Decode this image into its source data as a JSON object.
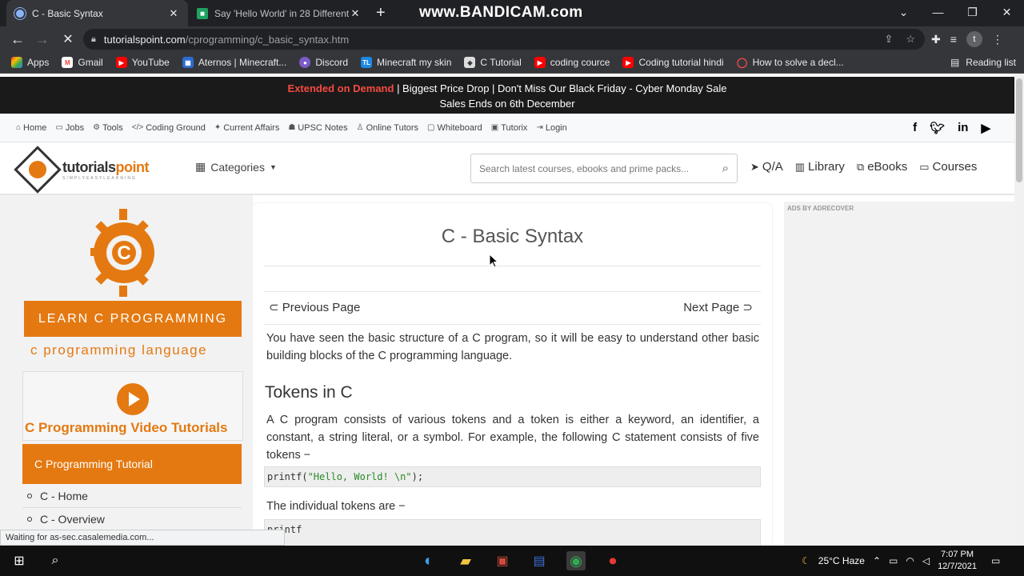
{
  "browser": {
    "tabs": [
      {
        "title": "C - Basic Syntax",
        "active": true
      },
      {
        "title": "Say 'Hello World' in 28 Different",
        "active": false
      }
    ],
    "recorder_watermark": "www.BANDICAM.com",
    "url_host": "tutorialspoint.com",
    "url_path": "/cprogramming/c_basic_syntax.htm",
    "bookmarks": [
      "Apps",
      "Gmail",
      "YouTube",
      "Aternos | Minecraft...",
      "Discord",
      "Minecraft my skin",
      "C Tutorial",
      "coding cource",
      "Coding tutorial hindi",
      "How to solve a decl..."
    ],
    "reading_list": "Reading list",
    "avatar_letter": "t",
    "status_text": "Waiting for as-sec.casalemedia.com..."
  },
  "promo": {
    "highlight": "Extended on Demand",
    "text": " | Biggest Price Drop | Don't Miss Our Black Friday - Cyber Monday Sale",
    "line2": "Sales Ends on 6th December"
  },
  "topnav": [
    "Home",
    "Jobs",
    "Tools",
    "Coding Ground",
    "Current Affairs",
    "UPSC Notes",
    "Online Tutors",
    "Whiteboard",
    "Tutorix",
    "Login"
  ],
  "social": [
    "f",
    "t",
    "in",
    "yt"
  ],
  "header": {
    "brand_a": "tutorials",
    "brand_b": "point",
    "tagline": "SIMPLYEASYLEARNING",
    "categories": "Categories",
    "search_placeholder": "Search latest courses, ebooks and prime packs...",
    "links": [
      "Q/A",
      "Library",
      "eBooks",
      "Courses"
    ]
  },
  "sidebar": {
    "learn_banner": "LEARN C PROGRAMMING",
    "subtitle": "c programming language",
    "video_title": "C Programming Video Tutorials",
    "tutorial_button": "C Programming Tutorial",
    "items": [
      "C - Home",
      "C - Overview"
    ]
  },
  "content": {
    "title": "C - Basic Syntax",
    "prev": "Previous Page",
    "next": "Next Page",
    "intro": "You have seen the basic structure of a C program, so it will be easy to understand other basic building blocks of the C programming language.",
    "h_tokens": "Tokens in C",
    "tokens_para": "A C program consists of various tokens and a token is either a keyword, an identifier, a constant, a string literal, or a symbol. For example, the following C statement consists of five tokens −",
    "code1_fn": "printf(",
    "code1_str": "\"Hello, World! \\n\"",
    "code1_end": ");",
    "tokens_list_intro": "The individual tokens are −",
    "code2": "printf"
  },
  "ads": {
    "label": "ADS BY ADRECOVER"
  },
  "taskbar": {
    "weather": "25°C  Haze",
    "time": "7:07 PM",
    "date": "12/7/2021"
  }
}
